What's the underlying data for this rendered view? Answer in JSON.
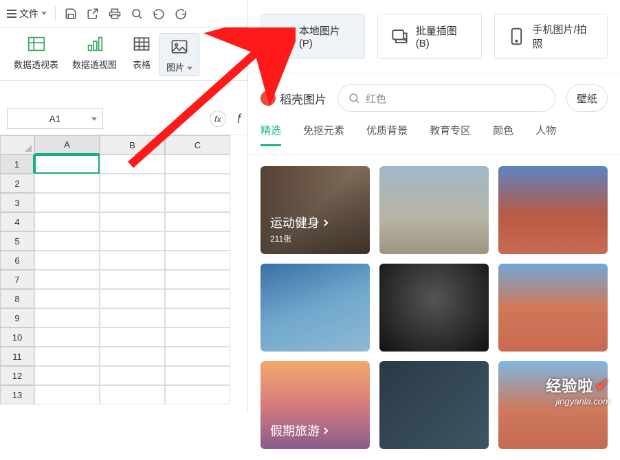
{
  "topbar": {
    "file": "文件"
  },
  "ribbon": {
    "pivot_table": "数据透视表",
    "pivot_chart": "数据透视图",
    "table": "表格",
    "image": "图片"
  },
  "cellref": "A1",
  "columns": [
    "A",
    "B",
    "C"
  ],
  "rows": [
    "1",
    "2",
    "3",
    "4",
    "5",
    "6",
    "7",
    "8",
    "9",
    "10",
    "11",
    "12",
    "13"
  ],
  "panel": {
    "btn_local": "本地图片(P)",
    "btn_batch": "批量插图(B)",
    "btn_phone": "手机图片/拍照",
    "brand": "稻壳图片",
    "search_placeholder": "红色",
    "pill": "壁纸"
  },
  "cats": [
    "精选",
    "免抠元素",
    "优质背景",
    "教育专区",
    "颜色",
    "人物"
  ],
  "cards": {
    "c1_title": "运动健身",
    "c1_count": "211张",
    "c7_title": "假期旅游"
  },
  "watermark": {
    "line1": "经验啦",
    "line2": "jingyanla.com"
  }
}
